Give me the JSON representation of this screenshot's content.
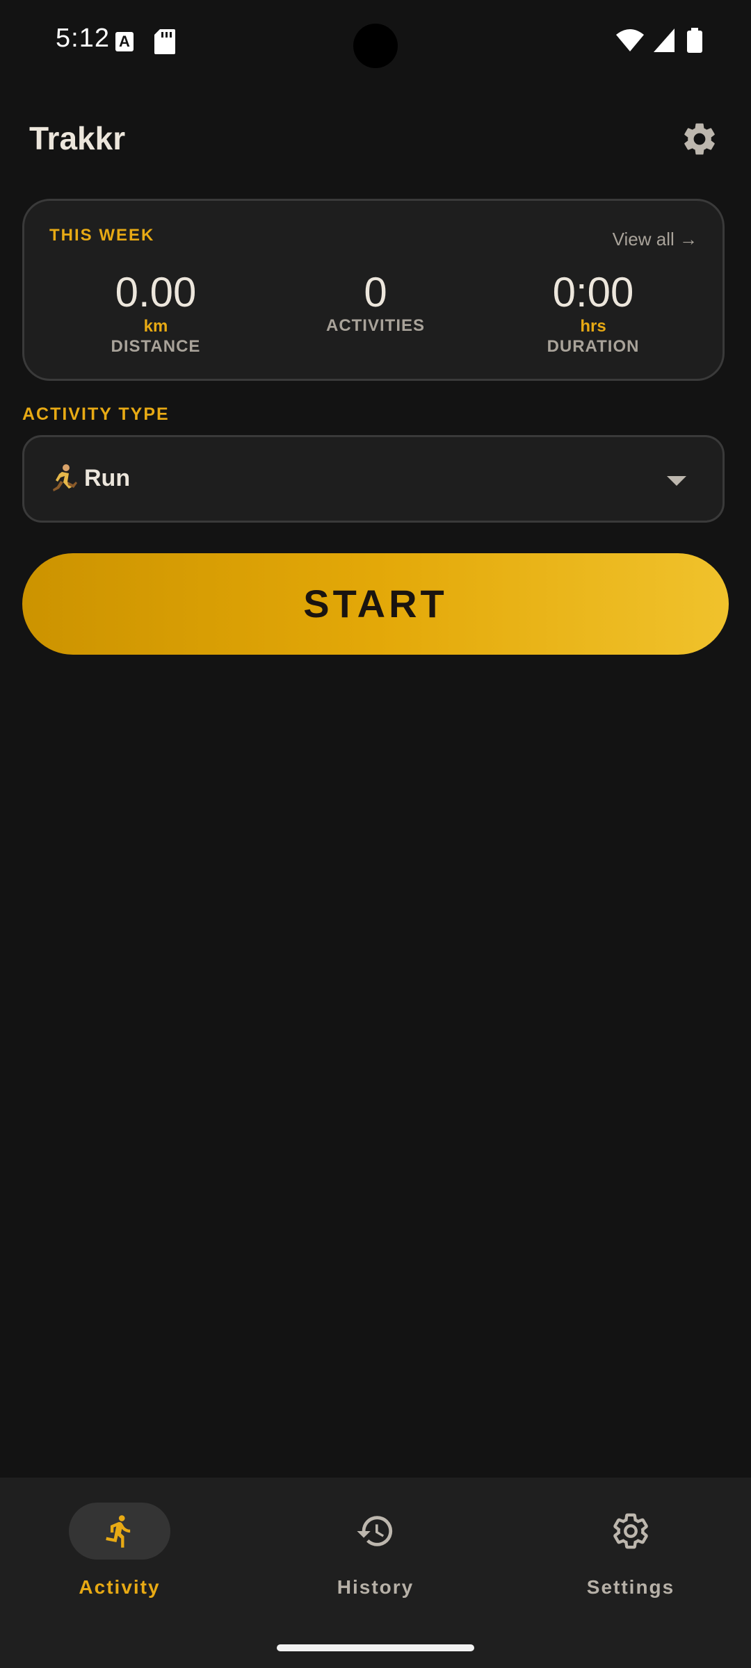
{
  "status_bar": {
    "time": "5:12"
  },
  "header": {
    "title": "Trakkr"
  },
  "week_card": {
    "label": "THIS WEEK",
    "view_all": "View all →",
    "stats": [
      {
        "value": "0.00",
        "unit": "km",
        "label": "DISTANCE"
      },
      {
        "value": "0",
        "label": "ACTIVITIES"
      },
      {
        "value": "0:00",
        "unit": "hrs",
        "label": "DURATION"
      }
    ]
  },
  "activity_type": {
    "label": "ACTIVITY TYPE",
    "selected": "Run",
    "icon": "runner-icon"
  },
  "start_button": {
    "label": "START"
  },
  "bottom_nav": {
    "items": [
      {
        "label": "Activity",
        "icon": "run-icon",
        "active": true
      },
      {
        "label": "History",
        "icon": "history-icon",
        "active": false
      },
      {
        "label": "Settings",
        "icon": "gear-icon",
        "active": false
      }
    ]
  },
  "colors": {
    "background": "#131313",
    "accent": "#e8aa14",
    "card": "#1e1e1e",
    "nav": "#1f1f1f"
  }
}
